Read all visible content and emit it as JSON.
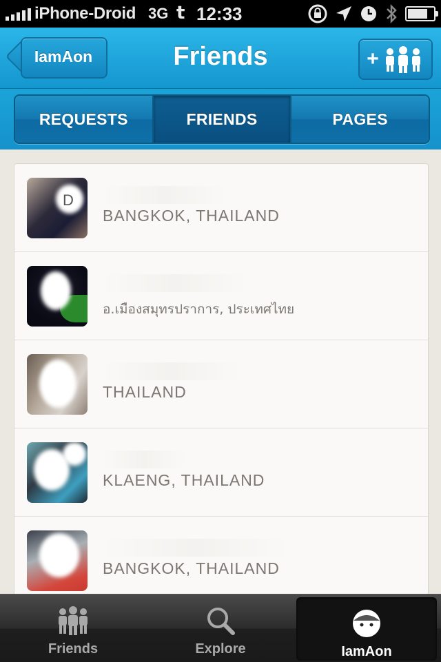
{
  "status_bar": {
    "carrier": "iPhone-Droid",
    "network": "3G",
    "time": "12:33",
    "battery_level": 0.8
  },
  "nav": {
    "back_label": "IamAon",
    "title": "Friends",
    "add_icon": "add-friends-icon"
  },
  "segments": [
    {
      "label": "REQUESTS",
      "active": false
    },
    {
      "label": "FRIENDS",
      "active": true
    },
    {
      "label": "PAGES",
      "active": false
    }
  ],
  "friends": [
    {
      "location": "BANGKOK, THAILAND"
    },
    {
      "location": "อ.เมืองสมุทรปราการ, ประเทศไทย"
    },
    {
      "location": "THAILAND"
    },
    {
      "location": "KLAENG, THAILAND"
    },
    {
      "location": "BANGKOK, THAILAND"
    }
  ],
  "tabbar": {
    "tabs": [
      {
        "label": "Friends",
        "icon": "friends-icon",
        "active": false
      },
      {
        "label": "Explore",
        "icon": "search-icon",
        "active": false
      },
      {
        "label": "IamAon",
        "icon": "profile-icon",
        "active": true
      }
    ]
  }
}
